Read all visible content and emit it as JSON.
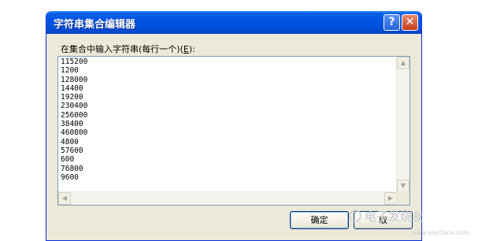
{
  "window": {
    "title": "字符串集合编辑器",
    "help_glyph": "?",
    "close_glyph": "✕"
  },
  "prompt": {
    "label_start": "在集合中输入字符串(每行一个)(",
    "accelerator": "E",
    "label_end": "):"
  },
  "list": {
    "lines": [
      "115200",
      "1200",
      "128000",
      "14400",
      "19200",
      "230400",
      "256000",
      "38400",
      "460800",
      "4800",
      "57600",
      "600",
      "76800",
      "9600"
    ]
  },
  "scrollbars": {
    "up_glyph": "▲",
    "down_glyph": "▼",
    "left_glyph": "◀",
    "right_glyph": "▶"
  },
  "buttons": {
    "ok_label": "确定",
    "cancel_label": "取"
  },
  "watermark": {
    "brand": "电子发烧友",
    "url": "www.elecfans.com"
  },
  "colors": {
    "title_bar": "#0054e3",
    "window_bg": "#ece9d8",
    "close_button": "#c43d1b"
  }
}
